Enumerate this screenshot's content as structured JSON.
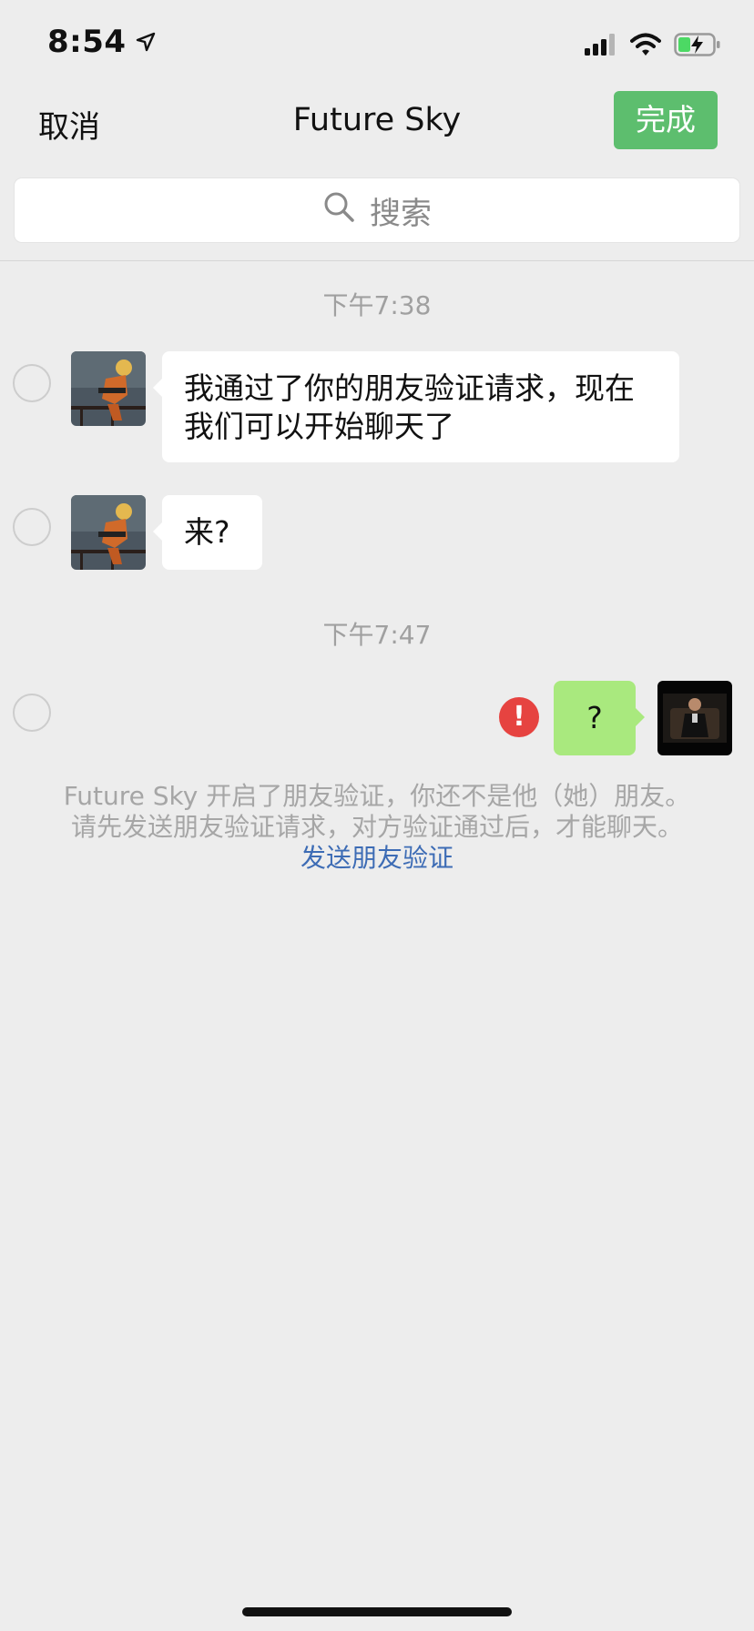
{
  "status_bar": {
    "time": "8:54",
    "icons": [
      "location-arrow-icon",
      "signal-icon",
      "wifi-icon",
      "battery-charging-icon"
    ]
  },
  "nav": {
    "cancel_label": "取消",
    "title": "Future Sky",
    "done_label": "完成"
  },
  "search": {
    "placeholder": "搜索"
  },
  "chat": {
    "timestamp_1": "下午7:38",
    "timestamp_2": "下午7:47",
    "messages": [
      {
        "direction": "incoming",
        "line1": "我通过了你的朋友验证请求，现在",
        "line2": "我们可以开始聊天了"
      },
      {
        "direction": "incoming",
        "text": "来?"
      },
      {
        "direction": "outgoing",
        "text": "?",
        "status": "failed"
      }
    ]
  },
  "notice": {
    "line1": "Future Sky 开启了朋友验证，你还不是他（她）朋友。",
    "line2": "请先发送朋友验证请求，对方验证通过后，才能聊天。",
    "link": "发送朋友验证"
  },
  "colors": {
    "background": "#ededed",
    "done_button": "#5dbe6e",
    "outgoing_bubble": "#a9e97e",
    "error": "#e64340",
    "link": "#3d6cb5"
  }
}
